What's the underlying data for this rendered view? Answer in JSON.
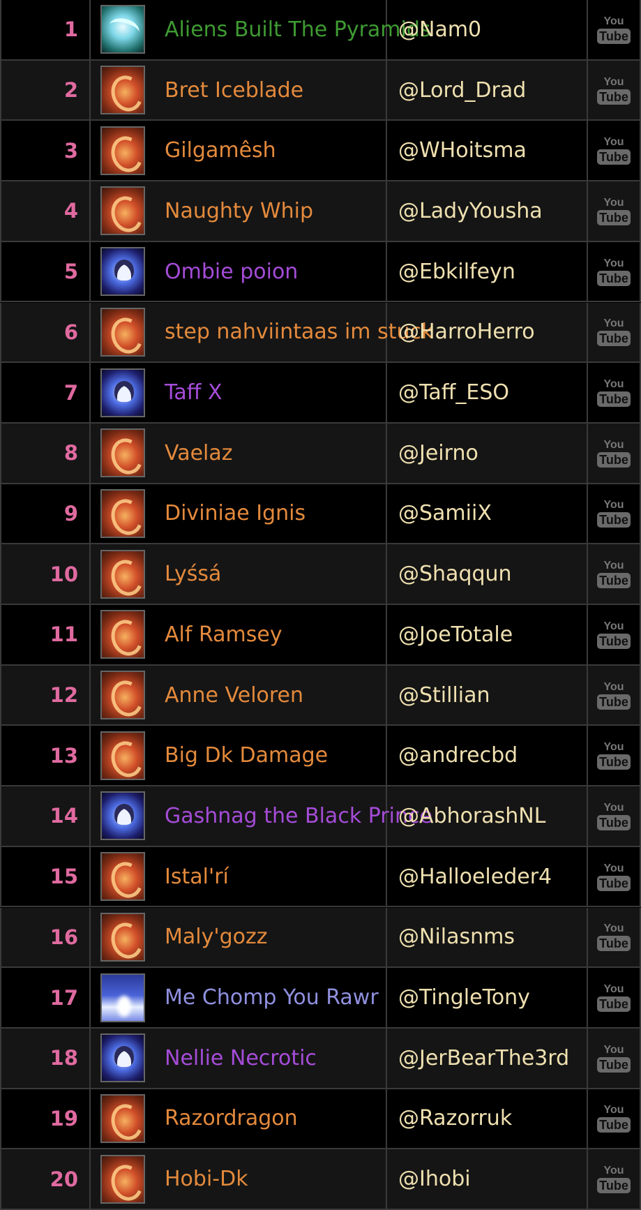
{
  "colors": {
    "rank": "#e06aa0",
    "account": "#efe0b0",
    "class_orange": "#e48a3c",
    "class_purple": "#a54cd8",
    "class_green": "#3f9a33",
    "class_periwinkle": "#9090e0"
  },
  "youtube_icon": {
    "top": "You",
    "bottom": "Tube"
  },
  "rows": [
    {
      "rank": "1",
      "name": "Aliens Built The Pyramids",
      "account": "@Nam0",
      "icon": "dragon-icon",
      "color": "#3f9a33"
    },
    {
      "rank": "2",
      "name": "Bret Iceblade",
      "account": "@Lord_Drad",
      "icon": "fire-icon",
      "color": "#e48a3c"
    },
    {
      "rank": "3",
      "name": "Gilgamêsh",
      "account": "@WHoitsma",
      "icon": "fire-icon",
      "color": "#e48a3c"
    },
    {
      "rank": "4",
      "name": "Naughty Whip",
      "account": "@LadyYousha",
      "icon": "fire-icon",
      "color": "#e48a3c"
    },
    {
      "rank": "5",
      "name": "Ombie poion",
      "account": "@Ebkilfeyn",
      "icon": "skull-icon",
      "color": "#a54cd8"
    },
    {
      "rank": "6",
      "name": "step nahviintaas im stuck",
      "account": "@HarroHerro",
      "icon": "fire-icon",
      "color": "#e48a3c"
    },
    {
      "rank": "7",
      "name": "Taff X",
      "account": "@Taff_ESO",
      "icon": "skull-icon",
      "color": "#a54cd8"
    },
    {
      "rank": "8",
      "name": "Vaelaz",
      "account": "@Jeirno",
      "icon": "fire-icon",
      "color": "#e48a3c"
    },
    {
      "rank": "9",
      "name": "Diviniae Ignis",
      "account": "@SamiiX",
      "icon": "fire-icon",
      "color": "#e48a3c"
    },
    {
      "rank": "10",
      "name": "Lyśsá",
      "account": "@Shaqqun",
      "icon": "fire-icon",
      "color": "#e48a3c"
    },
    {
      "rank": "11",
      "name": "Alf Ramsey",
      "account": "@JoeTotale",
      "icon": "fire-icon",
      "color": "#e48a3c"
    },
    {
      "rank": "12",
      "name": "Anne Veloren",
      "account": "@Stillian",
      "icon": "fire-icon",
      "color": "#e48a3c"
    },
    {
      "rank": "13",
      "name": "Big Dk Damage",
      "account": "@andrecbd",
      "icon": "fire-icon",
      "color": "#e48a3c"
    },
    {
      "rank": "14",
      "name": "Gashnag the Black Prince",
      "account": "@AbhorashNL",
      "icon": "skull-icon",
      "color": "#a54cd8"
    },
    {
      "rank": "15",
      "name": "Istal'rí",
      "account": "@Halloeleder4",
      "icon": "fire-icon",
      "color": "#e48a3c"
    },
    {
      "rank": "16",
      "name": "Maly'gozz",
      "account": "@Nilasnms",
      "icon": "fire-icon",
      "color": "#e48a3c"
    },
    {
      "rank": "17",
      "name": "Me Chomp You Rawr",
      "account": "@TingleTony",
      "icon": "light-icon",
      "color": "#9090e0"
    },
    {
      "rank": "18",
      "name": "Nellie Necrotic",
      "account": "@JerBearThe3rd",
      "icon": "skull-icon",
      "color": "#a54cd8"
    },
    {
      "rank": "19",
      "name": "Razordragon",
      "account": "@Razorruk",
      "icon": "fire-icon",
      "color": "#e48a3c"
    },
    {
      "rank": "20",
      "name": "Hobi-Dk",
      "account": "@Ihobi",
      "icon": "fire-icon",
      "color": "#e48a3c"
    }
  ]
}
